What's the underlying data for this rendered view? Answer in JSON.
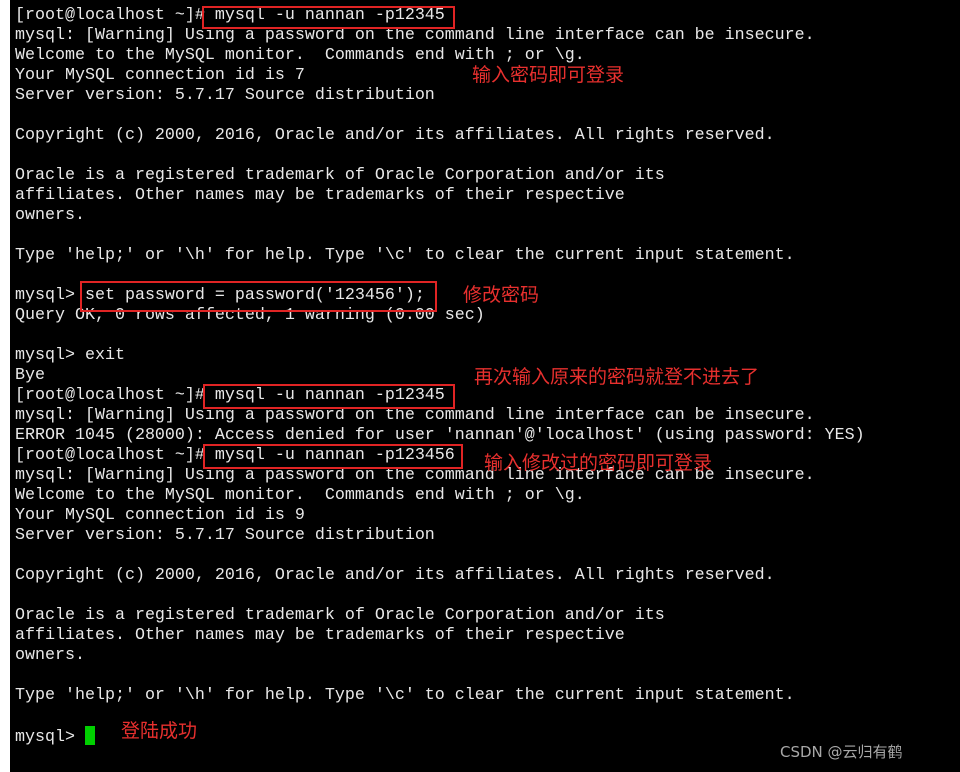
{
  "terminal": {
    "lines": [
      "[root@localhost ~]# mysql -u nannan -p12345",
      "mysql: [Warning] Using a password on the command line interface can be insecure.",
      "Welcome to the MySQL monitor.  Commands end with ; or \\g.",
      "Your MySQL connection id is 7",
      "Server version: 5.7.17 Source distribution",
      "",
      "Copyright (c) 2000, 2016, Oracle and/or its affiliates. All rights reserved.",
      "",
      "Oracle is a registered trademark of Oracle Corporation and/or its",
      "affiliates. Other names may be trademarks of their respective",
      "owners.",
      "",
      "Type 'help;' or '\\h' for help. Type '\\c' to clear the current input statement.",
      "",
      "mysql> set password = password('123456');",
      "Query OK, 0 rows affected, 1 warning (0.00 sec)",
      "",
      "mysql> exit",
      "Bye",
      "[root@localhost ~]# mysql -u nannan -p12345",
      "mysql: [Warning] Using a password on the command line interface can be insecure.",
      "ERROR 1045 (28000): Access denied for user 'nannan'@'localhost' (using password: YES)",
      "[root@localhost ~]# mysql -u nannan -p123456",
      "mysql: [Warning] Using a password on the command line interface can be insecure.",
      "Welcome to the MySQL monitor.  Commands end with ; or \\g.",
      "Your MySQL connection id is 9",
      "Server version: 5.7.17 Source distribution",
      "",
      "Copyright (c) 2000, 2016, Oracle and/or its affiliates. All rights reserved.",
      "",
      "Oracle is a registered trademark of Oracle Corporation and/or its",
      "affiliates. Other names may be trademarks of their respective",
      "owners.",
      "",
      "Type 'help;' or '\\h' for help. Type '\\c' to clear the current input statement.",
      ""
    ],
    "prompt_line": "mysql> "
  },
  "annotations": [
    {
      "text": "输入密码即可登录"
    },
    {
      "text": "修改密码"
    },
    {
      "text": "再次输入原来的密码就登不进去了"
    },
    {
      "text": "输入修改过的密码即可登录"
    },
    {
      "text": "登陆成功"
    }
  ],
  "watermark": "CSDN @云归有鹤",
  "colors": {
    "terminal_bg": "#000000",
    "terminal_text": "#e8e8e8",
    "annotation_red": "#e8302e",
    "cursor_green": "#00d000"
  }
}
